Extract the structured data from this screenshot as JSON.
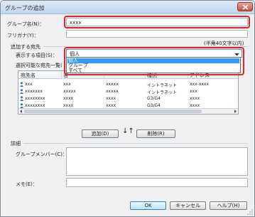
{
  "window": {
    "title": "グループの追加"
  },
  "form": {
    "group_name_label": "グループ名(N)：",
    "group_name_value": "xxxx",
    "furigana_label": "フリガナ(Y)：",
    "furigana_value": "",
    "furigana_hint": "(半角40文字以内)"
  },
  "members_section": {
    "title": "追加する宛先",
    "display_item_label": "表示する項目(S)：",
    "display_item_selected": "個人",
    "options": [
      "個人",
      "グループ",
      "すべて"
    ],
    "available_list_label": "選択可能な宛先一覧(",
    "columns": [
      "宛先名",
      "名",
      "",
      "種別",
      "アドレス"
    ],
    "rows": [
      {
        "name": "xxx",
        "c2": "xxx",
        "c3": "xxxxx",
        "type": "イントラネット",
        "addr": "xxx-xxxx"
      },
      {
        "name": "xxxxxxx",
        "c2": "xxxxx",
        "c3": "xxxxx",
        "type": "イントラネット",
        "addr": "xxx"
      },
      {
        "name": "xxxxxxxx",
        "c2": "xxxx",
        "c3": "xxxx",
        "type": "G3/G4",
        "addr": "xxxx"
      },
      {
        "name": "xxxxxxxx",
        "c2": "xxxx",
        "c3": "xxxx",
        "type": "G3/G4",
        "addr": "xxxx"
      }
    ]
  },
  "transfer": {
    "add_label": "追加(D)",
    "remove_label": "削除(R)",
    "arrows": "↓↑"
  },
  "details": {
    "title": "詳細",
    "members_label": "グループメンバー(C)：",
    "memo_label": "メモ(E)："
  },
  "footer": {
    "ok_label": "OK",
    "cancel_label": "キャンセル",
    "help_label": "ヘルプ(H)"
  },
  "colors": {
    "highlight": "#e0242d",
    "selection": "#3399ff"
  },
  "icons": {
    "close": "close-icon",
    "user": "user-icon",
    "dropdown": "chevron-down-icon"
  }
}
